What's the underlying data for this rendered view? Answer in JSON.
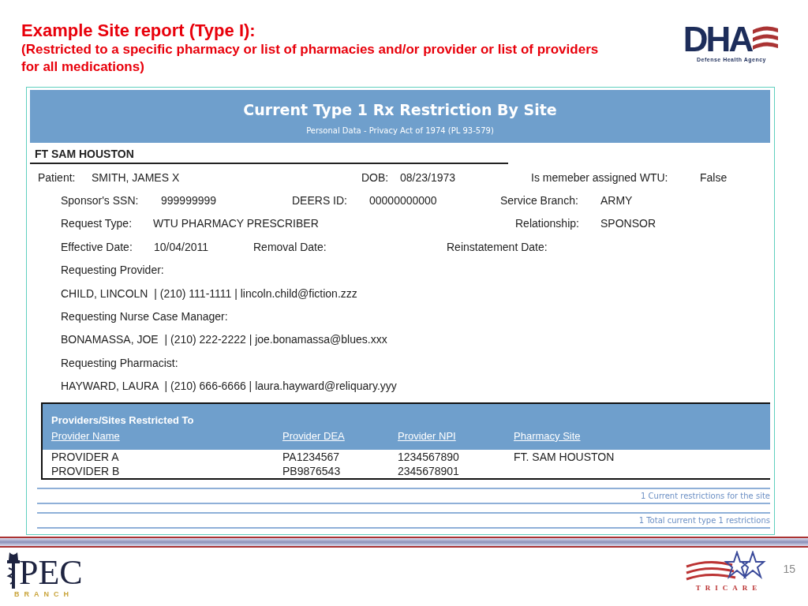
{
  "slide": {
    "title": "Example Site report (Type I):",
    "subtitle": "(Restricted to a specific pharmacy or list of pharmacies and/or provider or list of providers for all medications)",
    "logo": {
      "wordmark": "DHA",
      "tagline": "Defense Health Agency"
    }
  },
  "report": {
    "title": "Current Type 1 Rx Restriction By Site",
    "notice": "Personal Data - Privacy Act of 1974 (PL 93-579)",
    "site": "FT SAM HOUSTON",
    "field_rows": [
      [
        {
          "label": "Patient:",
          "value": "SMITH, JAMES X"
        },
        {
          "label": "DOB:",
          "value": "08/23/1973"
        },
        {
          "label": "Is memeber assigned WTU:",
          "value": "False"
        }
      ],
      [
        {
          "label": "Sponsor's SSN:",
          "value": "999999999"
        },
        {
          "label": "DEERS ID:",
          "value": "00000000000"
        },
        {
          "label": "Service Branch:",
          "value": "ARMY"
        }
      ],
      [
        {
          "label": "Request Type:",
          "value": "WTU PHARMACY PRESCRIBER"
        },
        {
          "label": "Relationship:",
          "value": "SPONSOR"
        }
      ],
      [
        {
          "label": "Effective Date:",
          "value": "10/04/2011"
        },
        {
          "label": "Removal Date:"
        },
        {
          "label": "Reinstatement Date:"
        }
      ]
    ],
    "contacts": [
      {
        "heading": "Requesting Provider:",
        "details": "CHILD, LINCOLN  | (210) 111-1111 | lincoln.child@fiction.zzz"
      },
      {
        "heading": "Requesting Nurse Case Manager:",
        "details": "BONAMASSA, JOE  | (210) 222-2222 | joe.bonamassa@blues.xxx"
      },
      {
        "heading": "Requesting Pharmacist:",
        "details": "HAYWARD, LAURA  | (210) 666-6666 | laura.hayward@reliquary.yyy"
      }
    ],
    "providers": {
      "title": "Providers/Sites Restricted To",
      "columns": [
        "Provider Name",
        "Provider DEA",
        "Provider NPI",
        "Pharmacy Site"
      ],
      "rows": [
        [
          "PROVIDER A",
          "PA1234567",
          "1234567890",
          "FT. SAM HOUSTON"
        ],
        [
          "PROVIDER B",
          "PB9876543",
          "2345678901",
          ""
        ]
      ]
    },
    "totals": [
      "1 Current restrictions for the site",
      "1 Total current type 1 restrictions"
    ]
  },
  "footer": {
    "left_logo": {
      "wordmark": "PEC",
      "tagline": "BRANCH"
    },
    "right_logo": {
      "wordmark": "TRICARE"
    },
    "page_number": "15"
  }
}
